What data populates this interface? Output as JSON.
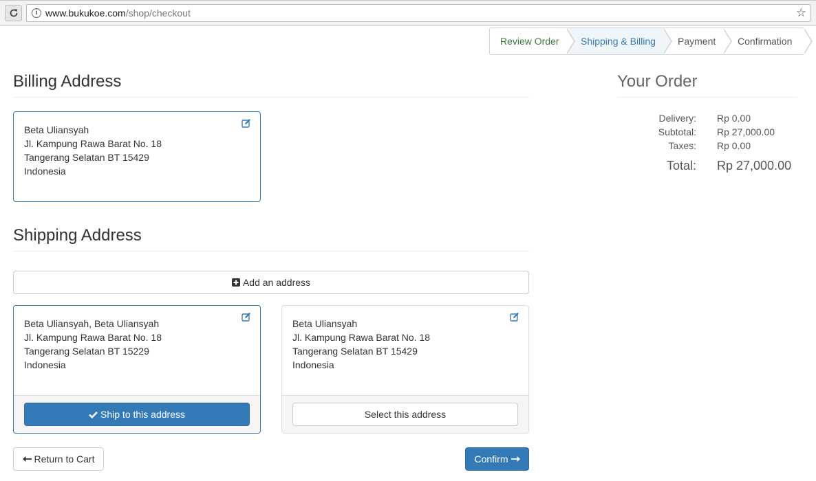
{
  "browser": {
    "url_host": "www.bukukoe.com",
    "url_path": "/shop/checkout"
  },
  "wizard": {
    "steps": [
      {
        "label": "Review Order",
        "state": "done"
      },
      {
        "label": "Shipping & Billing",
        "state": "active"
      },
      {
        "label": "Payment",
        "state": "todo"
      },
      {
        "label": "Confirmation",
        "state": "todo"
      }
    ]
  },
  "billing": {
    "title": "Billing Address",
    "lines": [
      "Beta Uliansyah",
      "Jl. Kampung Rawa Barat No. 18",
      "Tangerang Selatan BT 15429",
      "Indonesia"
    ]
  },
  "shipping": {
    "title": "Shipping Address",
    "add_label": "Add an address",
    "addresses": [
      {
        "lines": [
          "Beta Uliansyah, Beta Uliansyah",
          "Jl. Kampung Rawa Barat No. 18",
          "Tangerang Selatan BT 15229",
          "Indonesia"
        ],
        "button": "Ship to this address",
        "selected": true
      },
      {
        "lines": [
          "Beta Uliansyah",
          "Jl. Kampung Rawa Barat No. 18",
          "Tangerang Selatan BT 15429",
          "Indonesia"
        ],
        "button": "Select this address",
        "selected": false
      }
    ]
  },
  "actions": {
    "return_label": "Return to Cart",
    "confirm_label": "Confirm"
  },
  "order": {
    "title": "Your Order",
    "rows": [
      {
        "key": "Delivery:",
        "value": "Rp 0.00"
      },
      {
        "key": "Subtotal:",
        "value": "Rp 27,000.00"
      },
      {
        "key": "Taxes:",
        "value": "Rp 0.00"
      }
    ],
    "total_key": "Total:",
    "total_value": "Rp 27,000.00"
  },
  "colors": {
    "primary": "#337ab7",
    "done_step": "#3c763d"
  }
}
